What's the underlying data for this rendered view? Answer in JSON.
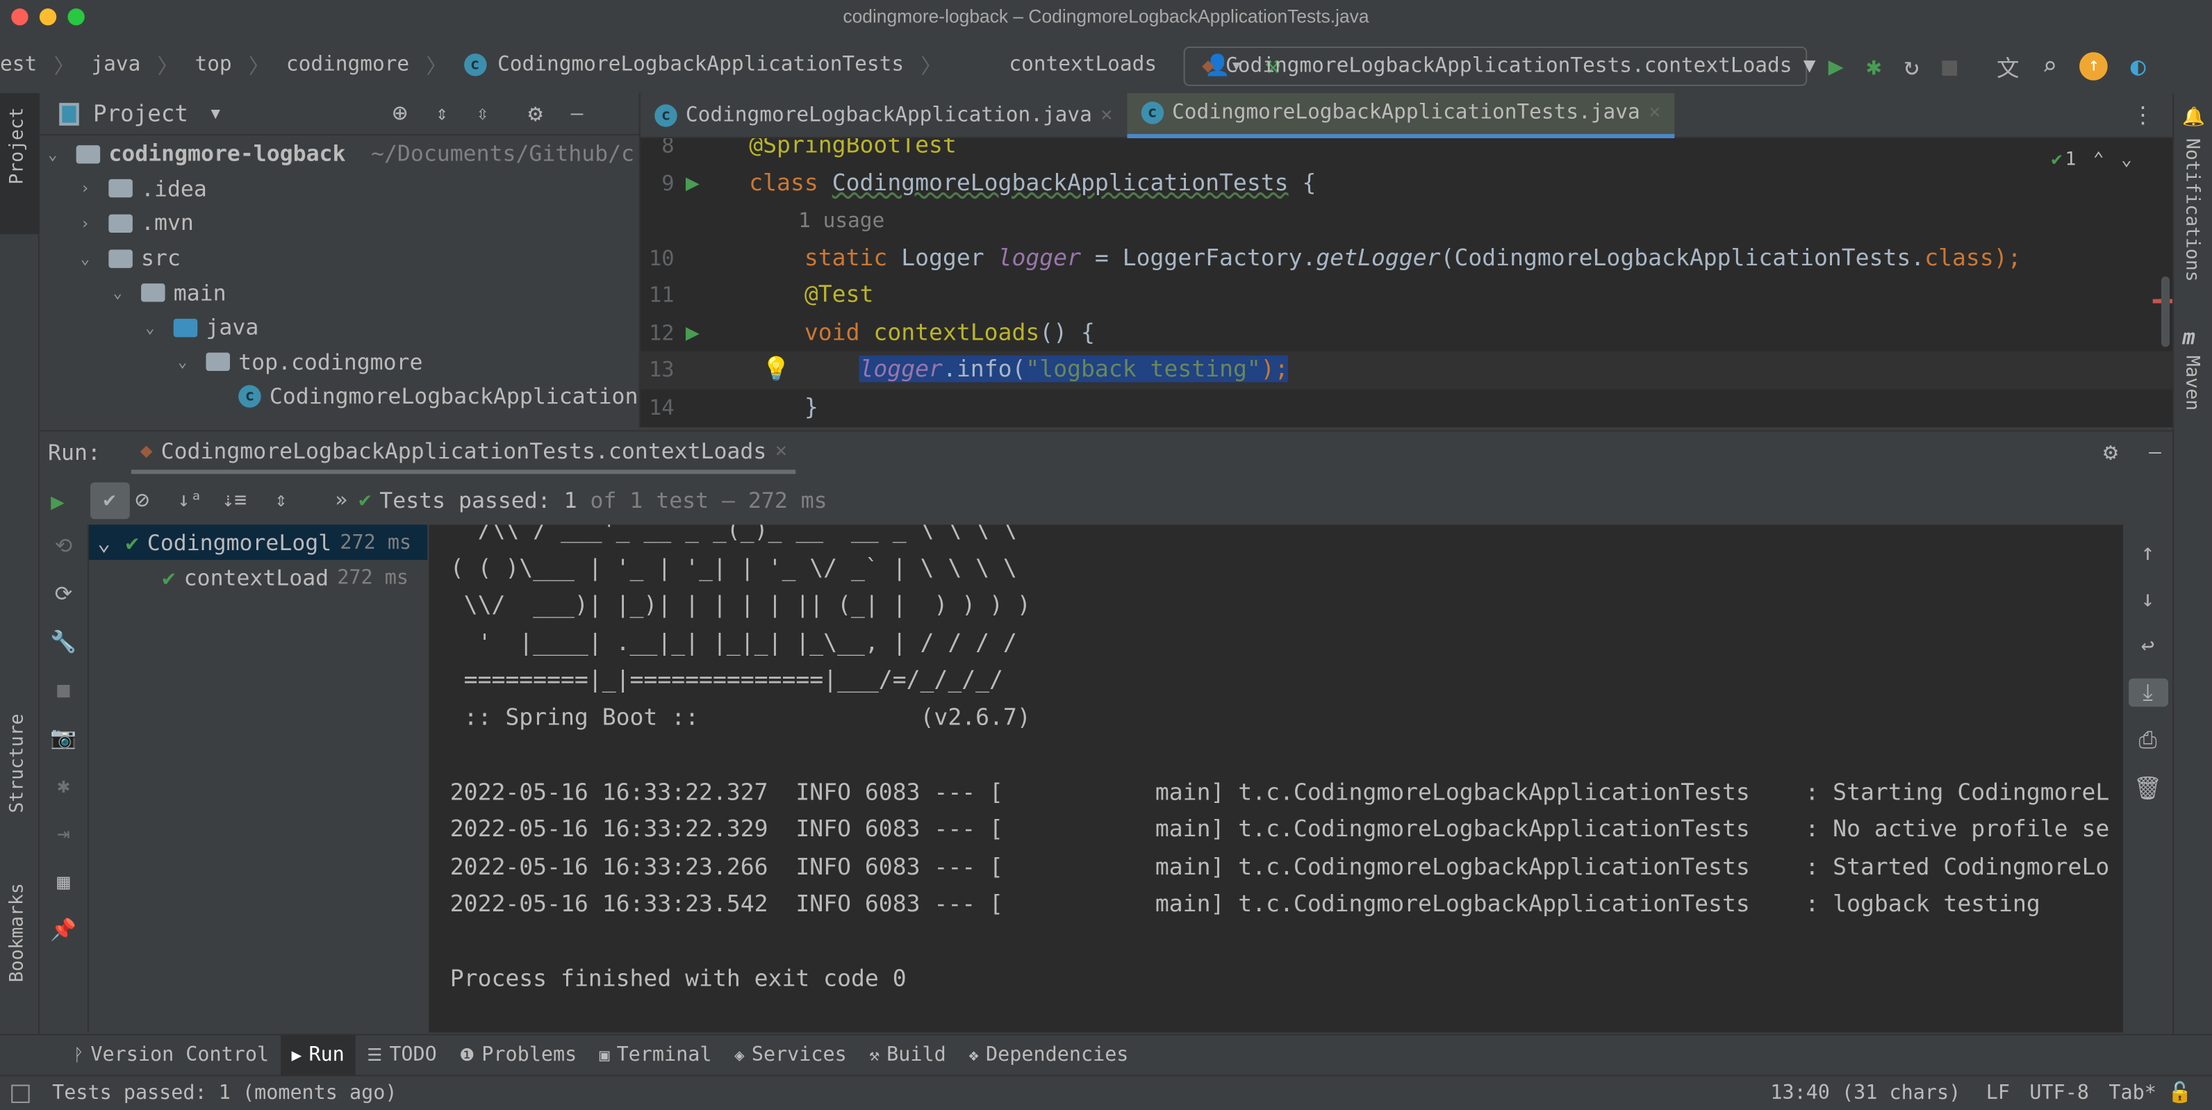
{
  "window": {
    "title": "codingmore-logback – CodingmoreLogbackApplicationTests.java"
  },
  "navbar": {
    "breadcrumbs": [
      "est",
      "java",
      "top",
      "codingmore",
      "CodingmoreLogbackApplicationTests"
    ],
    "method": "contextLoads",
    "run_config": "CodingmoreLogbackApplicationTests.contextLoads"
  },
  "project": {
    "title": "Project",
    "tree": [
      {
        "label": "codingmore-logback",
        "path": "~/Documents/Github/c",
        "depth": 0,
        "kind": "module",
        "expanded": true
      },
      {
        "label": ".idea",
        "depth": 1,
        "kind": "folder",
        "expanded": false
      },
      {
        "label": ".mvn",
        "depth": 1,
        "kind": "folder",
        "expanded": false
      },
      {
        "label": "src",
        "depth": 1,
        "kind": "folder",
        "expanded": true
      },
      {
        "label": "main",
        "depth": 2,
        "kind": "folder",
        "expanded": true
      },
      {
        "label": "java",
        "depth": 3,
        "kind": "source",
        "expanded": true
      },
      {
        "label": "top.codingmore",
        "depth": 4,
        "kind": "package",
        "expanded": true
      },
      {
        "label": "CodingmoreLogbackApplication",
        "depth": 5,
        "kind": "class"
      }
    ]
  },
  "editor": {
    "tabs": [
      {
        "label": "CodingmoreLogbackApplication.java",
        "active": false
      },
      {
        "label": "CodingmoreLogbackApplicationTests.java",
        "active": true
      }
    ],
    "inspection_count": "1",
    "lines": [
      {
        "num": "8",
        "tokens": [
          {
            "t": "@SpringBootTest",
            "k": "an"
          }
        ]
      },
      {
        "num": "9",
        "gutter": "run",
        "tokens": [
          {
            "t": "class ",
            "k": "kw"
          },
          {
            "t": "CodingmoreLogbackApplicationTests",
            "k": "cls"
          },
          {
            "t": " {",
            "k": "pl"
          }
        ]
      },
      {
        "num": "",
        "tokens": [
          {
            "t": "    1 usage",
            "k": "hint"
          }
        ]
      },
      {
        "num": "10",
        "tokens": [
          {
            "t": "    static ",
            "k": "kw"
          },
          {
            "t": "Logger ",
            "k": "pl"
          },
          {
            "t": "logger",
            "k": "fld"
          },
          {
            "t": " = LoggerFactory.",
            "k": "pl"
          },
          {
            "t": "getLogger",
            "k": "it"
          },
          {
            "t": "(CodingmoreLogbackApplicationTests.",
            "k": "pl"
          },
          {
            "t": "class",
            "k": "kw"
          },
          {
            "t": ");",
            "k": "kw"
          }
        ]
      },
      {
        "num": "11",
        "tokens": [
          {
            "t": "    @Test",
            "k": "an"
          }
        ]
      },
      {
        "num": "12",
        "gutter": "run",
        "tokens": [
          {
            "t": "    void ",
            "k": "kw"
          },
          {
            "t": "contextLoads",
            "k": "an"
          },
          {
            "t": "() {",
            "k": "pl"
          }
        ]
      },
      {
        "num": "13",
        "current": true,
        "tokens": [
          {
            "t": "        ",
            "k": "pl"
          },
          {
            "t": "logger",
            "k": "fld sel"
          },
          {
            "t": ".info(",
            "k": "pl sel"
          },
          {
            "t": "\"logback testing\"",
            "k": "str sel"
          },
          {
            "t": ");",
            "k": "kw sel"
          }
        ]
      },
      {
        "num": "14",
        "tokens": [
          {
            "t": "    }",
            "k": "pl"
          }
        ]
      }
    ]
  },
  "run": {
    "label": "Run:",
    "tab": "CodingmoreLogbackApplicationTests.contextLoads",
    "result_passed": "Tests passed: ",
    "result_count": "1",
    "result_rest": " of 1 test – 272 ms",
    "tests": [
      {
        "label": "CodingmoreLogl",
        "time": "272 ms",
        "depth": 0
      },
      {
        "label": "contextLoad",
        "time": "272 ms",
        "depth": 1
      }
    ],
    "console": [
      "  /\\\\ / ___'_ __ _ _(_)_ __  __ _ \\ \\ \\ \\",
      "( ( )\\___ | '_ | '_| | '_ \\/ _` | \\ \\ \\ \\",
      " \\\\/  ___)| |_)| | | | | || (_| |  ) ) ) )",
      "  '  |____| .__|_| |_|_| |_\\__, | / / / /",
      " =========|_|==============|___/=/_/_/_/",
      " :: Spring Boot ::                (v2.6.7)",
      "",
      "2022-05-16 16:33:22.327  INFO 6083 --- [           main] t.c.CodingmoreLogbackApplicationTests    : Starting CodingmoreL",
      "2022-05-16 16:33:22.329  INFO 6083 --- [           main] t.c.CodingmoreLogbackApplicationTests    : No active profile se",
      "2022-05-16 16:33:23.266  INFO 6083 --- [           main] t.c.CodingmoreLogbackApplicationTests    : Started CodingmoreLo",
      "2022-05-16 16:33:23.542  INFO 6083 --- [           main] t.c.CodingmoreLogbackApplicationTests    : logback testing",
      "",
      "Process finished with exit code 0"
    ]
  },
  "sidebars": {
    "left_top": "Project",
    "left_mid": "Structure",
    "left_bottom": "Bookmarks",
    "right_top": "Notifications",
    "right_mid": "Maven"
  },
  "toolwindows": [
    {
      "label": "Version Control",
      "icon": "branch-icon"
    },
    {
      "label": "Run",
      "icon": "play-icon",
      "active": true
    },
    {
      "label": "TODO",
      "icon": "list-icon"
    },
    {
      "label": "Problems",
      "icon": "problems-icon"
    },
    {
      "label": "Terminal",
      "icon": "terminal-icon"
    },
    {
      "label": "Services",
      "icon": "services-icon"
    },
    {
      "label": "Build",
      "icon": "hammer-icon"
    },
    {
      "label": "Dependencies",
      "icon": "dependencies-icon"
    }
  ],
  "status": {
    "message": "Tests passed: 1 (moments ago)",
    "position": "13:40 (31 chars)",
    "line_sep": "LF",
    "encoding": "UTF-8",
    "indent": "Tab*"
  },
  "colors": {
    "accent": "#4a88c7",
    "success": "#499c54",
    "keyword": "#cc7832",
    "annotation": "#bbb529",
    "string": "#6a8759",
    "field": "#9876aa"
  }
}
